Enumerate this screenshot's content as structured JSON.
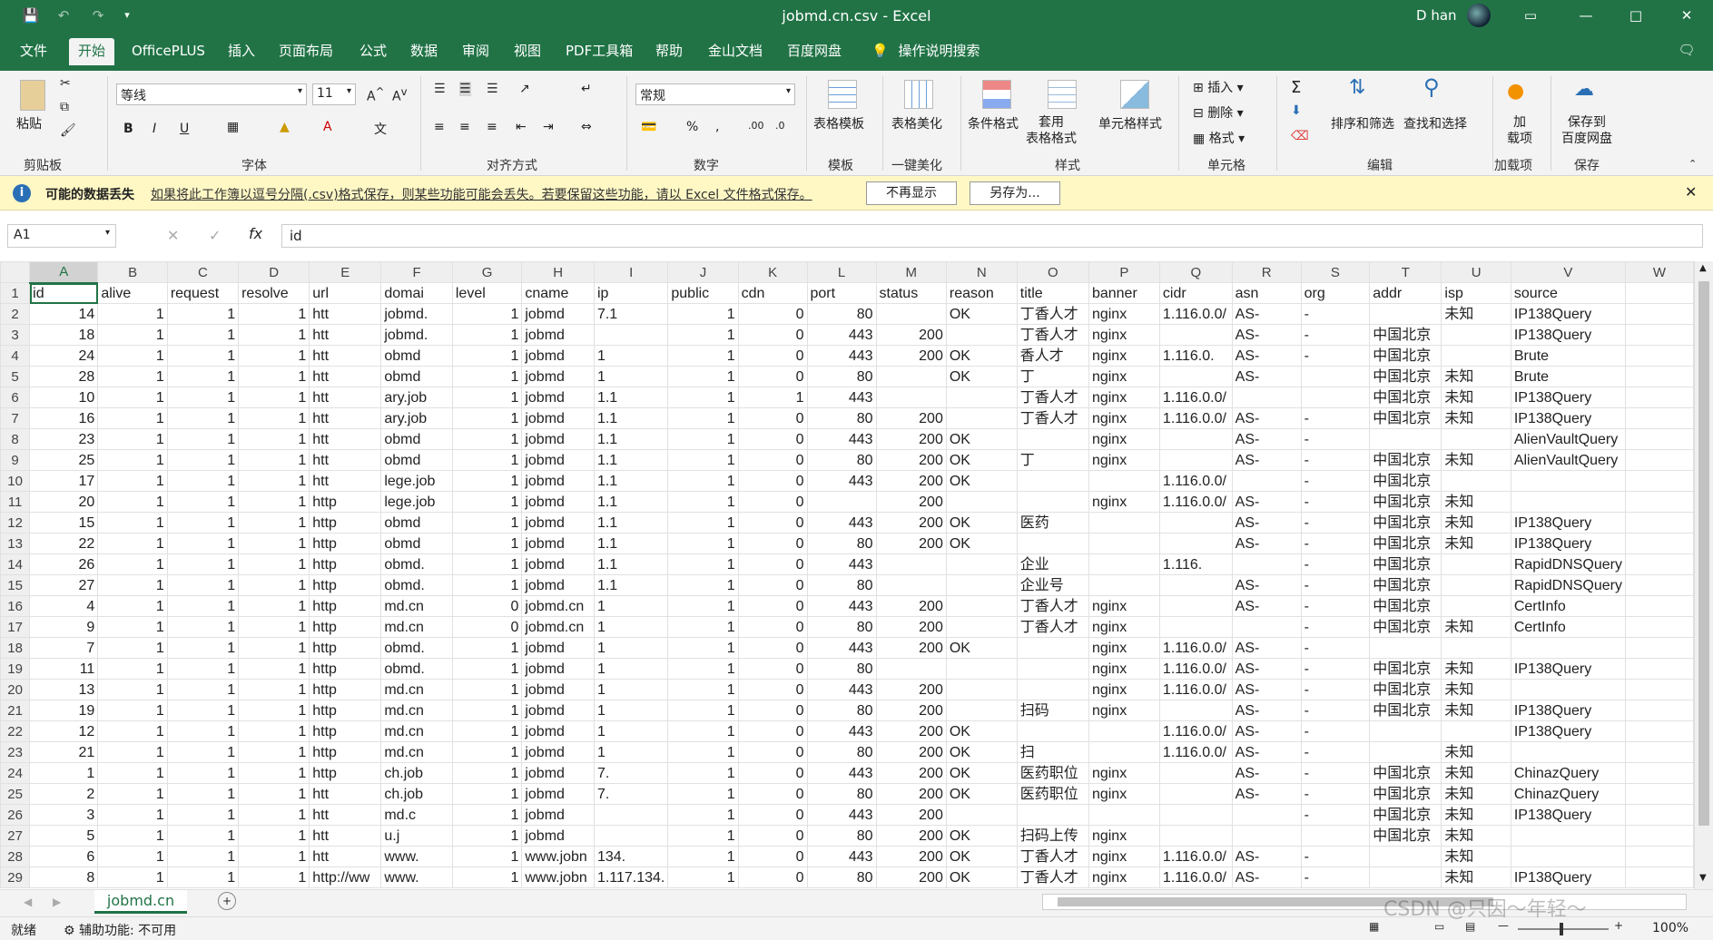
{
  "window": {
    "title": "jobmd.cn.csv  -  Excel",
    "user": "D han"
  },
  "tabs": [
    "文件",
    "开始",
    "OfficePLUS",
    "插入",
    "页面布局",
    "公式",
    "数据",
    "审阅",
    "视图",
    "PDF工具箱",
    "帮助",
    "金山文档",
    "百度网盘"
  ],
  "tell_me": "操作说明搜索",
  "ribbon": {
    "paste": "粘贴",
    "font_name": "等线",
    "font_size": "11",
    "number_format": "常规",
    "table_template": "表格模板",
    "table_beautify": "表格美化",
    "cond_format": "条件格式",
    "format_as_table": "套用\n表格格式",
    "cell_styles": "单元格样式",
    "insert": "插入",
    "delete": "删除",
    "format": "格式",
    "sort_filter": "排序和筛选",
    "find_select": "查找和选择",
    "addins": "加\n载项",
    "save_baidu": "保存到\n百度网盘",
    "groups": [
      "剪贴板",
      "字体",
      "对齐方式",
      "数字",
      "模板",
      "一键美化",
      "样式",
      "单元格",
      "编辑",
      "加载项",
      "保存"
    ]
  },
  "message_bar": {
    "title": "可能的数据丢失",
    "text": "如果将此工作簿以逗号分隔(.csv)格式保存，则某些功能可能会丢失。若要保留这些功能，请以 Excel 文件格式保存。",
    "btn1": "不再显示",
    "btn2": "另存为..."
  },
  "formula_bar": {
    "cell_ref": "A1",
    "fx": "fx",
    "content": "id"
  },
  "columns": [
    "A",
    "B",
    "C",
    "D",
    "E",
    "F",
    "G",
    "H",
    "I",
    "J",
    "K",
    "L",
    "M",
    "N",
    "O",
    "P",
    "Q",
    "R",
    "S",
    "T",
    "U",
    "V",
    "W"
  ],
  "headers": [
    "id",
    "alive",
    "request",
    "resolve",
    "url",
    "domai",
    "level",
    "cname",
    "ip",
    "public",
    "cdn",
    "port",
    "status",
    "reason",
    "title",
    "banner",
    "cidr",
    "asn",
    "org",
    "addr",
    "isp",
    "source",
    ""
  ],
  "rows": [
    [
      "14",
      "1",
      "1",
      "1",
      "htt",
      "jobmd.",
      "1",
      "jobmd",
      "7.1",
      "1",
      "0",
      "80",
      "",
      "OK",
      "丁香人才",
      "nginx",
      "1.116.0.0/",
      "AS-",
      "-",
      "",
      "未知",
      "IP138Query",
      ""
    ],
    [
      "18",
      "1",
      "1",
      "1",
      "htt",
      "jobmd.",
      "1",
      "jobmd",
      "",
      "1",
      "0",
      "443",
      "200",
      "",
      "丁香人才",
      "nginx",
      "",
      "AS-",
      "-",
      "中国北京",
      "",
      "IP138Query",
      ""
    ],
    [
      "24",
      "1",
      "1",
      "1",
      "htt",
      "obmd",
      "1",
      "jobmd",
      "1",
      "1",
      "0",
      "443",
      "200",
      "OK",
      "香人才",
      "nginx",
      "1.116.0.",
      "AS-",
      "-",
      "中国北京",
      "",
      "Brute",
      ""
    ],
    [
      "28",
      "1",
      "1",
      "1",
      "htt",
      "obmd",
      "1",
      "jobmd",
      "1",
      "1",
      "0",
      "80",
      "",
      "OK",
      "丁",
      "nginx",
      "",
      "AS-",
      "",
      "中国北京",
      "未知",
      "Brute",
      ""
    ],
    [
      "10",
      "1",
      "1",
      "1",
      "htt",
      "ary.job",
      "1",
      "jobmd",
      "1.1",
      "1",
      "1",
      "443",
      "",
      "",
      "丁香人才",
      "nginx",
      "1.116.0.0/",
      "",
      "",
      "中国北京",
      "未知",
      "IP138Query",
      ""
    ],
    [
      "16",
      "1",
      "1",
      "1",
      "htt",
      "ary.job",
      "1",
      "jobmd",
      "1.1",
      "1",
      "0",
      "80",
      "200",
      "",
      "丁香人才",
      "nginx",
      "1.116.0.0/",
      "AS-",
      "-",
      "中国北京",
      "未知",
      "IP138Query",
      ""
    ],
    [
      "23",
      "1",
      "1",
      "1",
      "htt",
      "obmd",
      "1",
      "jobmd",
      "1.1",
      "1",
      "0",
      "443",
      "200",
      "OK",
      "",
      "nginx",
      "",
      "AS-",
      "-",
      "",
      "",
      "AlienVaultQuery",
      ""
    ],
    [
      "25",
      "1",
      "1",
      "1",
      "htt",
      "obmd",
      "1",
      "jobmd",
      "1.1",
      "1",
      "0",
      "80",
      "200",
      "OK",
      "丁",
      "nginx",
      "",
      "AS-",
      "-",
      "中国北京",
      "未知",
      "AlienVaultQuery",
      ""
    ],
    [
      "17",
      "1",
      "1",
      "1",
      "htt",
      "lege.job",
      "1",
      "jobmd",
      "1.1",
      "1",
      "0",
      "443",
      "200",
      "OK",
      "",
      "",
      "1.116.0.0/",
      "",
      "-",
      "中国北京",
      "",
      "",
      ""
    ],
    [
      "20",
      "1",
      "1",
      "1",
      "http",
      "lege.job",
      "1",
      "jobmd",
      "1.1",
      "1",
      "0",
      "",
      "200",
      "",
      "",
      "nginx",
      "1.116.0.0/",
      "AS-",
      "-",
      "中国北京",
      "未知",
      "",
      ""
    ],
    [
      "15",
      "1",
      "1",
      "1",
      "http",
      "obmd",
      "1",
      "jobmd",
      "1.1",
      "1",
      "0",
      "443",
      "200",
      "OK",
      "医药",
      "",
      "",
      "AS-",
      "-",
      "中国北京",
      "未知",
      "IP138Query",
      ""
    ],
    [
      "22",
      "1",
      "1",
      "1",
      "http",
      "obmd",
      "1",
      "jobmd",
      "1.1",
      "1",
      "0",
      "80",
      "200",
      "OK",
      "",
      "",
      "",
      "AS-",
      "-",
      "中国北京",
      "未知",
      "IP138Query",
      ""
    ],
    [
      "26",
      "1",
      "1",
      "1",
      "http",
      "obmd.",
      "1",
      "jobmd",
      "1.1",
      "1",
      "0",
      "443",
      "",
      "",
      "企业",
      "",
      "1.116.",
      "",
      "-",
      "中国北京",
      "",
      "RapidDNSQuery",
      ""
    ],
    [
      "27",
      "1",
      "1",
      "1",
      "http",
      "obmd.",
      "1",
      "jobmd",
      "1.1",
      "1",
      "0",
      "80",
      "",
      "",
      "企业号",
      "",
      "",
      "AS-",
      "-",
      "中国北京",
      "",
      "RapidDNSQuery",
      ""
    ],
    [
      "4",
      "1",
      "1",
      "1",
      "http",
      "md.cn",
      "0",
      "jobmd.cn",
      "1",
      "1",
      "0",
      "443",
      "200",
      "",
      "丁香人才",
      "nginx",
      "",
      "AS-",
      "-",
      "中国北京",
      "",
      "CertInfo",
      ""
    ],
    [
      "9",
      "1",
      "1",
      "1",
      "http",
      "md.cn",
      "0",
      "jobmd.cn",
      "1",
      "1",
      "0",
      "80",
      "200",
      "",
      "丁香人才",
      "nginx",
      "",
      "",
      "-",
      "中国北京",
      "未知",
      "CertInfo",
      ""
    ],
    [
      "7",
      "1",
      "1",
      "1",
      "http",
      "obmd.",
      "1",
      "jobmd",
      "1",
      "1",
      "0",
      "443",
      "200",
      "OK",
      "",
      "nginx",
      "1.116.0.0/",
      "AS-",
      "-",
      "",
      "",
      "",
      ""
    ],
    [
      "11",
      "1",
      "1",
      "1",
      "http",
      "obmd.",
      "1",
      "jobmd",
      "1",
      "1",
      "0",
      "80",
      "",
      "",
      "",
      "nginx",
      "1.116.0.0/",
      "AS-",
      "-",
      "中国北京",
      "未知",
      "IP138Query",
      ""
    ],
    [
      "13",
      "1",
      "1",
      "1",
      "http",
      "md.cn",
      "1",
      "jobmd",
      "1",
      "1",
      "0",
      "443",
      "200",
      "",
      "",
      "nginx",
      "1.116.0.0/",
      "AS-",
      "-",
      "中国北京",
      "未知",
      "",
      ""
    ],
    [
      "19",
      "1",
      "1",
      "1",
      "http",
      "md.cn",
      "1",
      "jobmd",
      "1",
      "1",
      "0",
      "80",
      "200",
      "",
      "扫码",
      "nginx",
      "",
      "AS-",
      "-",
      "中国北京",
      "未知",
      "IP138Query",
      ""
    ],
    [
      "12",
      "1",
      "1",
      "1",
      "http",
      "md.cn",
      "1",
      "jobmd",
      "1",
      "1",
      "0",
      "443",
      "200",
      "OK",
      "",
      "",
      "1.116.0.0/",
      "AS-",
      "-",
      "",
      "",
      "IP138Query",
      ""
    ],
    [
      "21",
      "1",
      "1",
      "1",
      "http",
      "md.cn",
      "1",
      "jobmd",
      "1",
      "1",
      "0",
      "80",
      "200",
      "OK",
      "扫",
      "",
      "1.116.0.0/",
      "AS-",
      "-",
      "",
      "未知",
      "",
      ""
    ],
    [
      "1",
      "1",
      "1",
      "1",
      "http",
      "ch.job",
      "1",
      "jobmd",
      "7.",
      "1",
      "0",
      "443",
      "200",
      "OK",
      "医药职位",
      "nginx",
      "",
      "AS-",
      "-",
      "中国北京",
      "未知",
      "ChinazQuery",
      ""
    ],
    [
      "2",
      "1",
      "1",
      "1",
      "htt",
      "ch.job",
      "1",
      "jobmd",
      "7.",
      "1",
      "0",
      "80",
      "200",
      "OK",
      "医药职位",
      "nginx",
      "",
      "AS-",
      "-",
      "中国北京",
      "未知",
      "ChinazQuery",
      ""
    ],
    [
      "3",
      "1",
      "1",
      "1",
      "htt",
      "md.c",
      "1",
      "jobmd",
      "",
      "1",
      "0",
      "443",
      "200",
      "",
      "",
      "",
      "",
      "",
      "-",
      "中国北京",
      "未知",
      "IP138Query",
      ""
    ],
    [
      "5",
      "1",
      "1",
      "1",
      "htt",
      "u.j",
      "1",
      "jobmd",
      "",
      "1",
      "0",
      "80",
      "200",
      "OK",
      "扫码上传",
      "nginx",
      "",
      "",
      "",
      "中国北京",
      "未知",
      "",
      ""
    ],
    [
      "6",
      "1",
      "1",
      "1",
      "htt",
      "www.",
      "1",
      "www.jobn",
      "134.",
      "1",
      "0",
      "443",
      "200",
      "OK",
      "丁香人才",
      "nginx",
      "1.116.0.0/",
      "AS-",
      "-",
      "",
      "未知",
      "",
      ""
    ],
    [
      "8",
      "1",
      "1",
      "1",
      "http://ww",
      "www.",
      "1",
      "www.jobn",
      "1.117.134.",
      "1",
      "0",
      "80",
      "200",
      "OK",
      "丁香人才",
      "nginx",
      "1.116.0.0/",
      "AS-",
      "-",
      "",
      "未知",
      "IP138Query",
      ""
    ]
  ],
  "sheet_tab": "jobmd.cn",
  "status": {
    "ready": "就绪",
    "accessibility": "辅助功能: 不可用",
    "zoom": "100%"
  },
  "watermark": "CSDN @只因～年轻～"
}
